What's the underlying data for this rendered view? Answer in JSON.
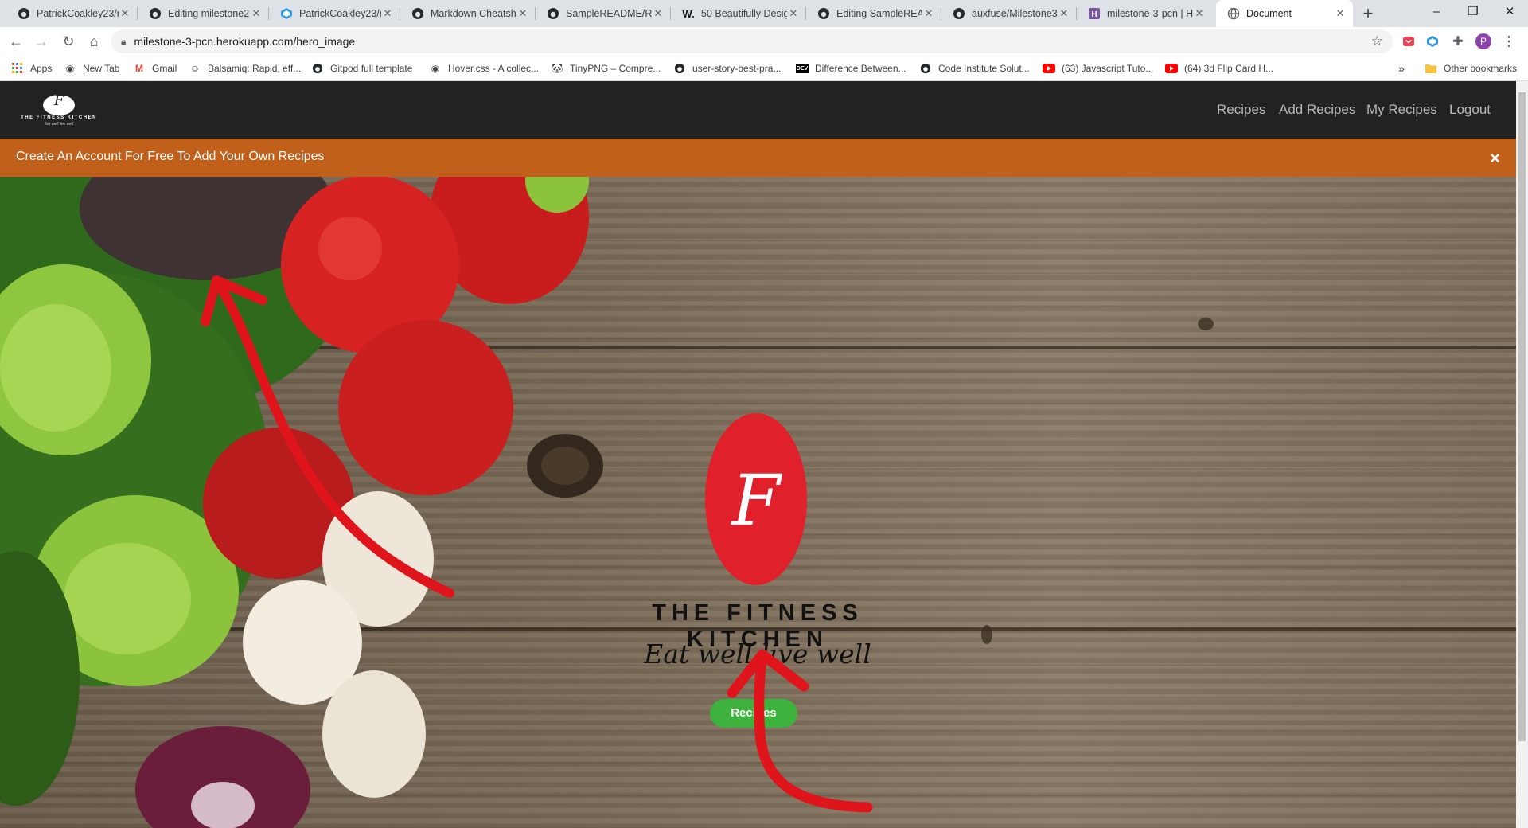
{
  "browser": {
    "tabs": [
      {
        "title": "PatrickCoakley23/m",
        "icon": "github-icon"
      },
      {
        "title": "Editing milestone2-",
        "icon": "github-icon"
      },
      {
        "title": "PatrickCoakley23/m",
        "icon": "codecov-icon"
      },
      {
        "title": "Markdown Cheatsh",
        "icon": "github-icon"
      },
      {
        "title": "SampleREADME/RE",
        "icon": "github-icon"
      },
      {
        "title": "50 Beautifully Desig",
        "icon": "webflow-icon"
      },
      {
        "title": "Editing SampleREA",
        "icon": "github-icon"
      },
      {
        "title": "auxfuse/Milestone3",
        "icon": "github-icon"
      },
      {
        "title": "milestone-3-pcn | H",
        "icon": "heroku-icon"
      },
      {
        "title": "Document",
        "icon": "globe-icon"
      }
    ],
    "new_tab_symbol": "+",
    "window_controls": {
      "minimize": "–",
      "restore": "❐",
      "close": "✕"
    },
    "url": "milestone-3-pcn.herokuapp.com/hero_image",
    "profile_initial": "P",
    "bookmarks": [
      {
        "label": "Apps",
        "icon": "apps-grid-icon"
      },
      {
        "label": "New Tab",
        "icon": "globe-icon"
      },
      {
        "label": "Gmail",
        "icon": "gmail-icon"
      },
      {
        "label": "Balsamiq: Rapid, eff...",
        "icon": "balsamiq-icon"
      },
      {
        "label": "Gitpod full template",
        "icon": "github-icon"
      },
      {
        "label": "Hover.css - A collec...",
        "icon": "globe-icon"
      },
      {
        "label": "TinyPNG – Compre...",
        "icon": "tinypng-icon"
      },
      {
        "label": "user-story-best-pra...",
        "icon": "github-icon"
      },
      {
        "label": "Difference Between...",
        "icon": "dev-icon"
      },
      {
        "label": "Code Institute Solut...",
        "icon": "github-icon"
      },
      {
        "label": "(63) Javascript Tuto...",
        "icon": "youtube-icon"
      },
      {
        "label": "(64) 3d Flip Card H...",
        "icon": "youtube-icon"
      }
    ],
    "bookmarks_overflow": "»",
    "other_bookmarks": "Other bookmarks"
  },
  "site": {
    "logo_title": "THE FITNESS KITCHEN",
    "logo_tagline": "Eat well live well",
    "logo_monogram": "F",
    "nav": [
      "Recipes",
      "Add Recipes",
      "My Recipes",
      "Logout"
    ],
    "alert_text": "Create An Account For Free To Add Your Own Recipes",
    "alert_close": "×",
    "hero": {
      "brand_title": "THE FITNESS KITCHEN",
      "brand_tagline": "Eat well live well",
      "monogram": "F",
      "button_label": "Recipes"
    }
  },
  "colors": {
    "nav_bg": "#222222",
    "alert_bg": "#c0601b",
    "button_bg": "#3db33d",
    "logo_red": "#e0202b",
    "annotation_red": "#e0151b"
  }
}
